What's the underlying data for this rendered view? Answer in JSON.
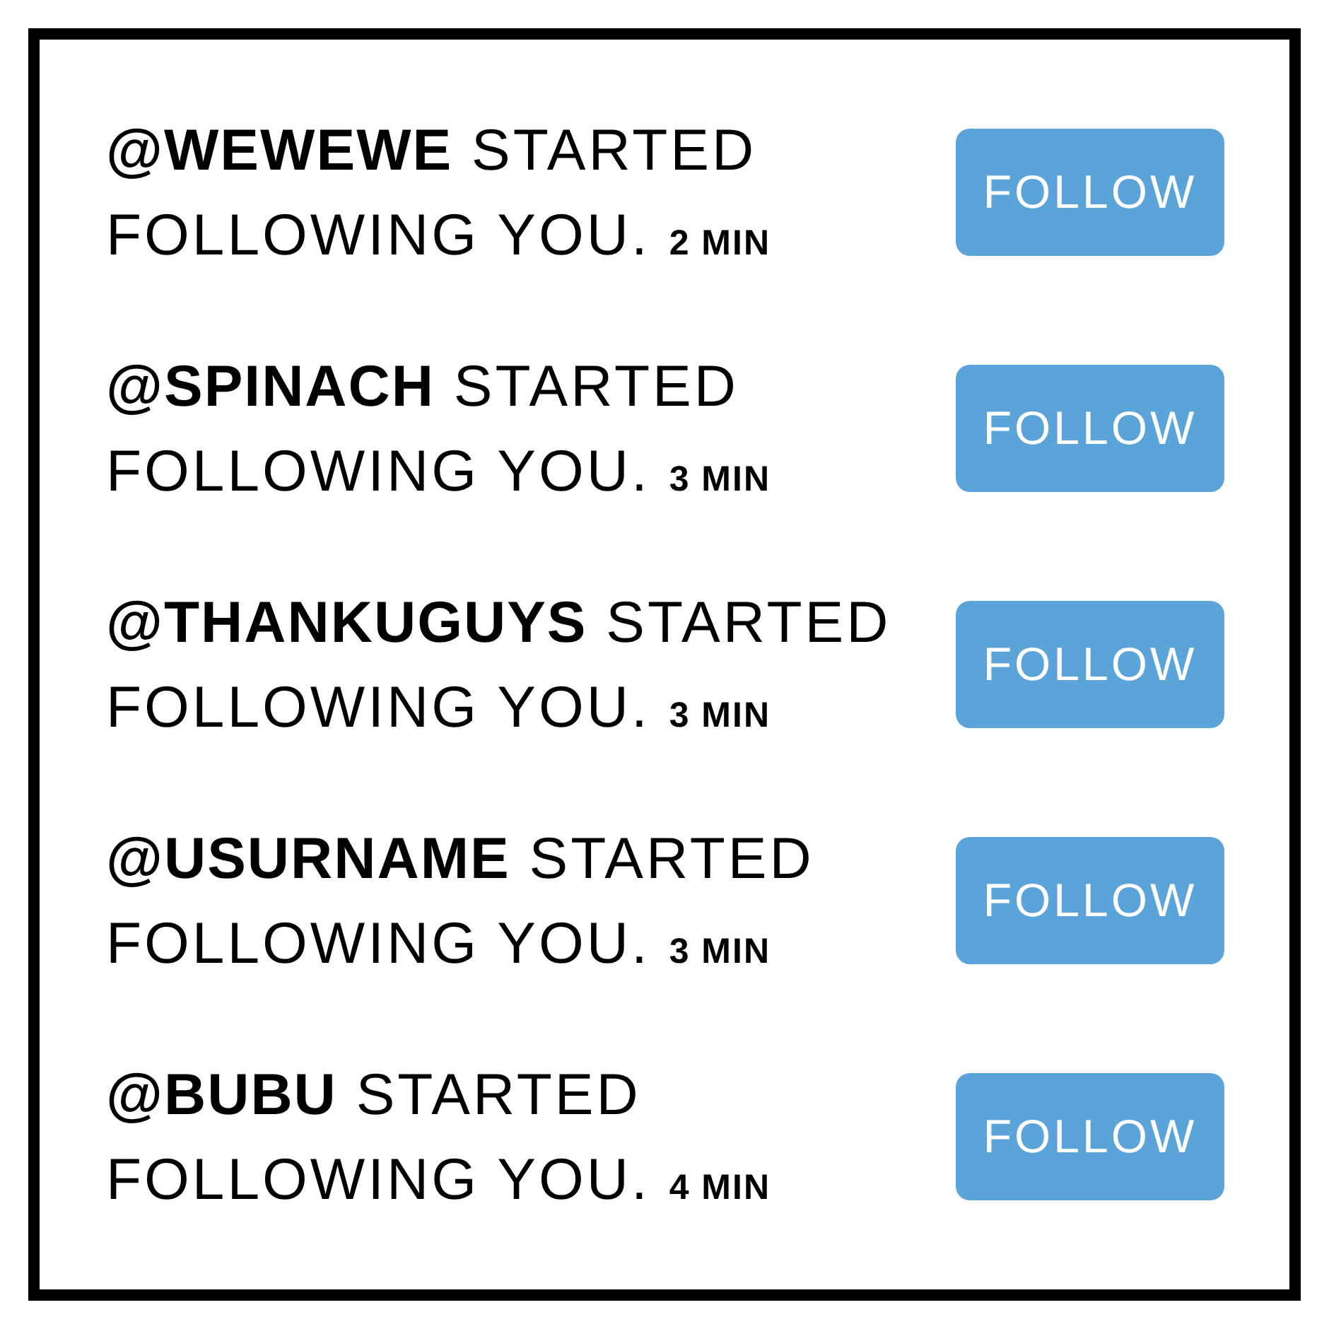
{
  "notifications": [
    {
      "message": "**@WEWEWE** STARTED FOLLOWING YOU.",
      "time": "2 MIN",
      "button": "FOLLOW"
    },
    {
      "message": "**@SPINACH** STARTED FOLLOWING YOU.",
      "time": "3 MIN",
      "button": "FOLLOW"
    },
    {
      "message": "**@THANKUGUYS** STARTED FOLLOWING YOU.",
      "time": "3 MIN",
      "button": "FOLLOW"
    },
    {
      "message": "**@USURNAME** STARTED FOLLOWING YOU.",
      "time": "3 MIN",
      "button": "FOLLOW"
    },
    {
      "message": "**@BUBU** STARTED FOLLOWING YOU.",
      "time": "4 MIN",
      "button": "FOLLOW"
    }
  ]
}
